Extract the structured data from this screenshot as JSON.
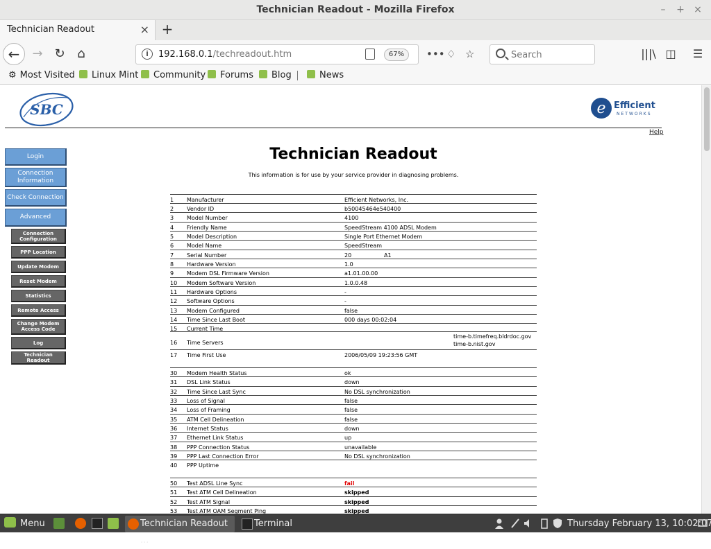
{
  "window": {
    "title": "Technician Readout - Mozilla Firefox"
  },
  "tabs": [
    {
      "label": "Technician Readout"
    }
  ],
  "navbar": {
    "url_host": "192.168.0.1",
    "url_path": "/techreadout.htm",
    "zoom": "67%",
    "search_placeholder": "Search"
  },
  "bookmarks": [
    {
      "label": "Most Visited",
      "icon": "gear-icon"
    },
    {
      "label": "Linux Mint",
      "icon": "mint-icon"
    },
    {
      "label": "Community",
      "icon": "mint-icon"
    },
    {
      "label": "Forums",
      "icon": "mint-icon"
    },
    {
      "label": "Blog",
      "icon": "mint-icon"
    },
    {
      "label": "News",
      "icon": "mint-icon"
    }
  ],
  "page": {
    "help": "Help",
    "title": "Technician Readout",
    "subtitle": "This information is for use by your service provider in diagnosing problems.",
    "brand_left": "SBC",
    "brand_right_1": "Efficient",
    "brand_right_2": "NETWORKS"
  },
  "sidebar": {
    "main": [
      {
        "label": "Login"
      },
      {
        "label": "Connection Information"
      },
      {
        "label": "Check Connection"
      },
      {
        "label": "Advanced"
      }
    ],
    "sub": [
      {
        "label": "Connection Configuration"
      },
      {
        "label": "PPP Location"
      },
      {
        "label": "Update Modem"
      },
      {
        "label": "Reset Modem"
      },
      {
        "label": "Statistics"
      },
      {
        "label": "Remote Access"
      },
      {
        "label": "Change Modem Access Code"
      },
      {
        "label": "Log"
      },
      {
        "label": "Technician Readout"
      }
    ]
  },
  "readout": [
    {
      "n": "1",
      "k": "Manufacturer",
      "v": "Efficient Networks, Inc."
    },
    {
      "n": "2",
      "k": "Vendor ID",
      "v": "b50045464e540400"
    },
    {
      "n": "3",
      "k": "Model Number",
      "v": "4100"
    },
    {
      "n": "4",
      "k": "Friendly Name",
      "v": "SpeedStream 4100 ADSL Modem"
    },
    {
      "n": "5",
      "k": "Model Description",
      "v": "Single Port Ethernet Modem"
    },
    {
      "n": "6",
      "k": "Model Name",
      "v": "SpeedStream"
    },
    {
      "n": "7",
      "k": "Serial Number",
      "v": "20",
      "v2": "A1"
    },
    {
      "n": "8",
      "k": "Hardware Version",
      "v": "1.0"
    },
    {
      "n": "9",
      "k": "Modem DSL Firmware Version",
      "v": "a1.01.00.00"
    },
    {
      "n": "10",
      "k": "Modem Software Version",
      "v": "1.0.0.48"
    },
    {
      "n": "11",
      "k": "Hardware Options",
      "v": "-"
    },
    {
      "n": "12",
      "k": "Software Options",
      "v": "-"
    },
    {
      "n": "13",
      "k": "Modem Configured",
      "v": "false"
    },
    {
      "n": "14",
      "k": "Time Since Last Boot",
      "v": "000 days 00:02:04"
    },
    {
      "n": "15",
      "k": "Current Time",
      "v": ""
    },
    {
      "n": "16",
      "k": "Time Servers",
      "v": "time-b.timefreq.bldrdoc.gov",
      "v2": "time-b.nist.gov"
    },
    {
      "n": "17",
      "k": "Time First Use",
      "v": "2006/05/09 19:23:56 GMT"
    },
    {
      "n": "30",
      "k": "Modem Health Status",
      "v": "ok"
    },
    {
      "n": "31",
      "k": "DSL Link Status",
      "v": "down"
    },
    {
      "n": "32",
      "k": "Time Since Last Sync",
      "v": "No DSL synchronization"
    },
    {
      "n": "33",
      "k": "Loss of Signal",
      "v": "false"
    },
    {
      "n": "34",
      "k": "Loss of Framing",
      "v": "false"
    },
    {
      "n": "35",
      "k": "ATM Cell Delineation",
      "v": "false"
    },
    {
      "n": "36",
      "k": "Internet Status",
      "v": "down"
    },
    {
      "n": "37",
      "k": "Ethernet Link Status",
      "v": "up"
    },
    {
      "n": "38",
      "k": "PPP Connection Status",
      "v": "unavailable"
    },
    {
      "n": "39",
      "k": "PPP Last Connection Error",
      "v": "No DSL synchronization"
    },
    {
      "n": "40",
      "k": "PPP Uptime",
      "v": ""
    },
    {
      "n": "50",
      "k": "Test ADSL Line Sync",
      "v": "fail"
    },
    {
      "n": "51",
      "k": "Test ATM Cell Delineation",
      "v": "skipped"
    },
    {
      "n": "52",
      "k": "Test ATM Signal",
      "v": "skipped"
    },
    {
      "n": "53",
      "k": "Test ATM OAM Segment Ping",
      "v": "skipped"
    }
  ],
  "taskbar": {
    "menu": "Menu",
    "windows": [
      {
        "label": "Technician Readout ..."
      },
      {
        "label": "Terminal"
      }
    ],
    "clock": "Thursday February 13, 10:02:07"
  },
  "colors": {
    "nav_blue": "#6b9fd6",
    "nav_gray": "#666666",
    "fail_red": "#e00000",
    "sbc_blue": "#2a5fa8",
    "taskbar": "#3e3e3e"
  }
}
